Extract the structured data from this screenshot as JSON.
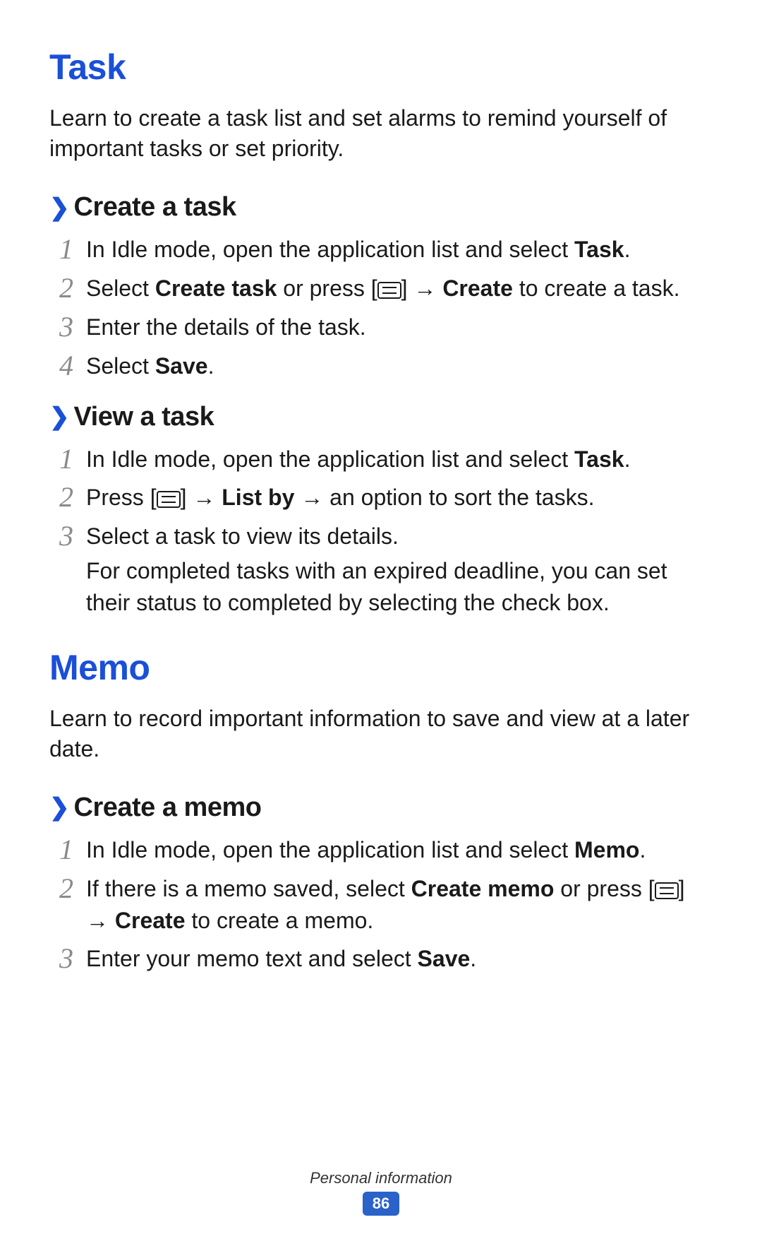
{
  "section_task": {
    "title": "Task",
    "intro": "Learn to create a task list and set alarms to remind yourself of important tasks or set priority.",
    "create": {
      "title": "Create a task",
      "step1_a": "In Idle mode, open the application list and select ",
      "step1_b": "Task",
      "step1_c": ".",
      "step2_a": "Select ",
      "step2_b": "Create task",
      "step2_c": " or press [",
      "step2_d": "] → ",
      "step2_e": "Create",
      "step2_f": " to create a task.",
      "step3": "Enter the details of the task.",
      "step4_a": "Select ",
      "step4_b": "Save",
      "step4_c": "."
    },
    "view": {
      "title": "View a task",
      "step1_a": "In Idle mode, open the application list and select ",
      "step1_b": "Task",
      "step1_c": ".",
      "step2_a": "Press [",
      "step2_b": "] → ",
      "step2_c": "List by",
      "step2_d": " → an option to sort the tasks.",
      "step3_a": "Select a task to view its details.",
      "step3_b": "For completed tasks with an expired deadline, you can set their status to completed by selecting the check box."
    }
  },
  "section_memo": {
    "title": "Memo",
    "intro": "Learn to record important information to save and view at a later date.",
    "create": {
      "title": "Create a memo",
      "step1_a": "In Idle mode, open the application list and select ",
      "step1_b": "Memo",
      "step1_c": ".",
      "step2_a": "If there is a memo saved, select ",
      "step2_b": "Create memo",
      "step2_c": " or press [",
      "step2_d": "] → ",
      "step2_e": "Create",
      "step2_f": " to create a memo.",
      "step3_a": "Enter your memo text and select ",
      "step3_b": "Save",
      "step3_c": "."
    }
  },
  "nums": {
    "n1": "1",
    "n2": "2",
    "n3": "3",
    "n4": "4"
  },
  "chevron": "❯",
  "footer": {
    "section": "Personal information",
    "page": "86"
  }
}
